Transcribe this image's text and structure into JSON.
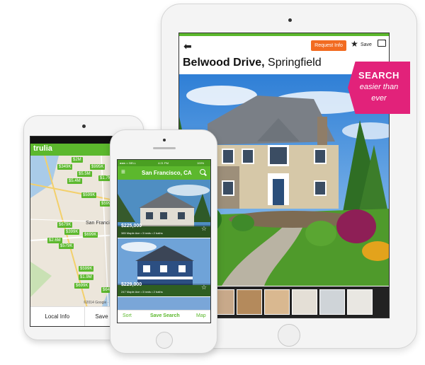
{
  "tablet": {
    "topbar": {
      "request_info_label": "Request Info",
      "save_label": "Save"
    },
    "listing": {
      "street": "Belwood Drive,",
      "city": "Springfield"
    }
  },
  "badge": {
    "line1": "SEARCH",
    "line2": "easier than",
    "line3": "ever"
  },
  "android": {
    "app_logo": "trulia",
    "map_labels": [
      "San Francisco"
    ],
    "price_tags": [
      "$2M",
      "$349K",
      "$995K",
      "$5.5M",
      "$5.4M",
      "$1.7M",
      "$599K",
      "$599K",
      "$679K",
      "$399K",
      "$699K",
      "$2.6M",
      "$579K",
      "$599K",
      "$1.9M",
      "$699K",
      "$649K"
    ],
    "map_credit": "©2014 Google · Map data",
    "bottom": {
      "left_label": "Local Info",
      "right_label": "Save Search"
    }
  },
  "iphone": {
    "status": {
      "carrier": "●●●○○ BELL",
      "time": "4:21 PM",
      "battery": "100%"
    },
    "app_title": "San Francisco, CA",
    "listings": [
      {
        "price": "$225,000",
        "address": "385 Maple Ave • 3 beds • 2 baths"
      },
      {
        "price": "$229,000",
        "address": "247 Maple Ave • 3 beds • 2 baths"
      }
    ],
    "bottom": {
      "sort_label": "Sort",
      "save_search_label": "Save Search",
      "map_label": "Map"
    }
  },
  "colors": {
    "brand_green": "#5cb82d",
    "request_orange": "#f26b21",
    "badge_pink": "#e2227a"
  }
}
